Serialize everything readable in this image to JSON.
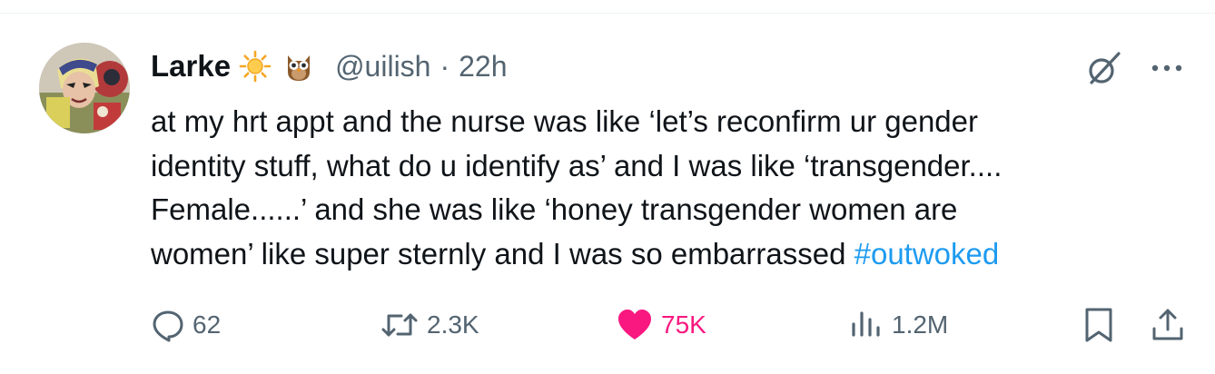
{
  "tweet": {
    "author_name": "Larke",
    "author_emojis": [
      "sun-emoji",
      "owl-emoji"
    ],
    "handle": "@uilish",
    "separator": "·",
    "time": "22h",
    "text_lines": [
      "at my hrt appt and the nurse was like ‘let’s reconfirm ur gender",
      "identity stuff, what do u identify as’ and I was like ‘transgender....",
      "Female......’ and she was like ‘honey transgender women are",
      "women’ like super sternly and I was so embarrassed "
    ],
    "hashtag": "#outwoked"
  },
  "actions": {
    "replies": "62",
    "reposts": "2.3K",
    "likes": "75K",
    "views": "1.2M"
  },
  "icons": {
    "reply": "reply-icon",
    "repost": "repost-icon",
    "like": "heart-icon",
    "views": "views-icon",
    "bookmark": "bookmark-icon",
    "share": "share-icon",
    "grok": "grok-icon",
    "more": "more-icon"
  },
  "colors": {
    "text": "#0f1419",
    "secondary": "#536471",
    "link": "#1d9bf0",
    "like": "#f91880"
  }
}
